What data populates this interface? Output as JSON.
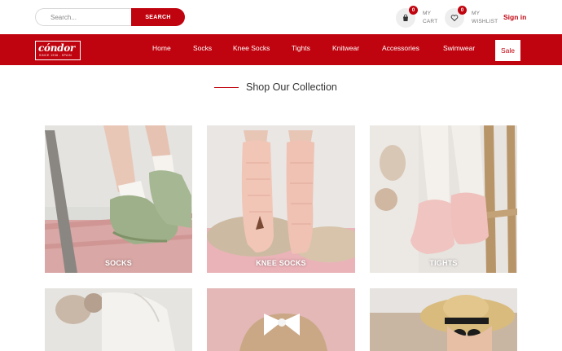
{
  "header": {
    "search": {
      "placeholder": "Search...",
      "button_label": "SEARCH"
    },
    "cart": {
      "count": "0",
      "label_line1": "MY",
      "label_line2": "CART",
      "icon": "shopping-bag-icon"
    },
    "wishlist": {
      "count": "0",
      "label_line1": "MY",
      "label_line2": "WISHLIST",
      "icon": "heart-icon"
    },
    "signin_label": "Sign in"
  },
  "brand": {
    "name": "cóndor",
    "tagline": "SINCE 1936 - SPAIN"
  },
  "nav": {
    "items": [
      {
        "label": "Home"
      },
      {
        "label": "Socks"
      },
      {
        "label": "Knee Socks"
      },
      {
        "label": "Tights"
      },
      {
        "label": "Knitwear"
      },
      {
        "label": "Accessories"
      },
      {
        "label": "Swimwear"
      }
    ],
    "sale_label": "Sale"
  },
  "section": {
    "title": "Shop Our Collection"
  },
  "collections": [
    {
      "label": "SOCKS"
    },
    {
      "label": "KNEE SOCKS"
    },
    {
      "label": "TIGHTS"
    },
    {
      "label": ""
    },
    {
      "label": ""
    },
    {
      "label": ""
    }
  ],
  "colors": {
    "brand_red": "#c0040f",
    "white": "#ffffff"
  }
}
